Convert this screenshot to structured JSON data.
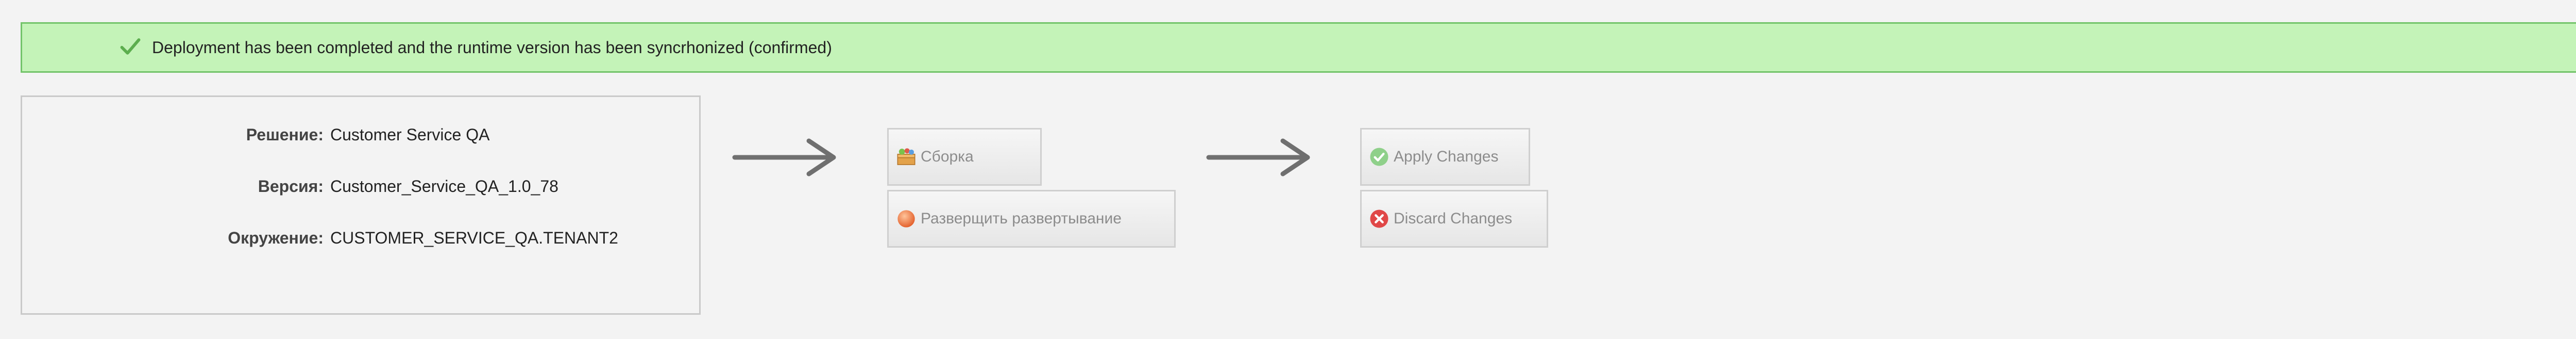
{
  "banner": {
    "message": "Deployment has been completed and the runtime version has been syncrhonized (confirmed)",
    "icon": "check-icon",
    "background_color": "#c4f3b8",
    "border_color": "#73c46a"
  },
  "info": {
    "rows": [
      {
        "label": "Решение:",
        "value": "Customer Service QA"
      },
      {
        "label": "Версия:",
        "value": "Customer_Service_QA_1.0_78"
      },
      {
        "label": "Окружение:",
        "value": "CUSTOMER_SERVICE_QA.TENANT2"
      }
    ]
  },
  "actions": {
    "build_label": "Сборка",
    "build_icon": "package-icon",
    "finish_deploy_label": "Разверщить развертывание",
    "finish_deploy_icon": "orange-circle-icon",
    "apply_label": "Apply Changes",
    "apply_icon": "green-check-circle-icon",
    "discard_label": "Discard Changes",
    "discard_icon": "red-x-circle-icon"
  }
}
